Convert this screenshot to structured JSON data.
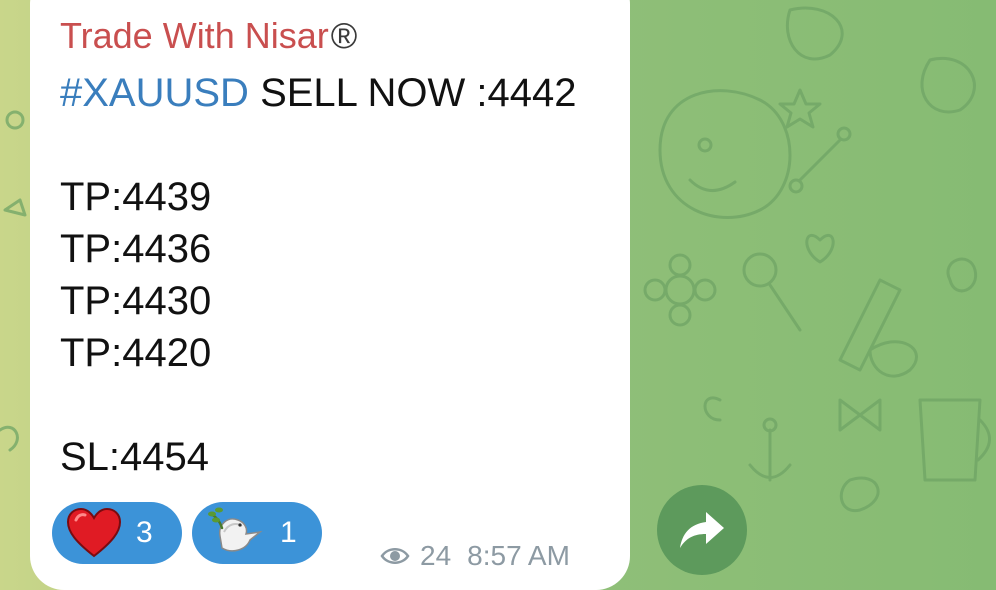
{
  "message": {
    "channel_name": "Trade With Nisar",
    "registered_mark": "®",
    "hashtag": "#XAUUSD",
    "headline_rest": " SELL NOW :4442",
    "targets": [
      "TP:4439",
      "TP:4436",
      "TP:4430",
      "TP:4420"
    ],
    "stop_loss": "SL:4454",
    "views": "24",
    "time": "8:57 AM"
  },
  "reactions": [
    {
      "icon": "heart-icon",
      "count": "3"
    },
    {
      "icon": "dove-icon",
      "count": "1"
    }
  ],
  "colors": {
    "channel_name": "#c94f4f",
    "hashtag": "#3a7ebd",
    "reaction_bg": "#3c93d8",
    "forward_bg": "#5d9a5c",
    "chat_bg": "#8fbf78"
  }
}
